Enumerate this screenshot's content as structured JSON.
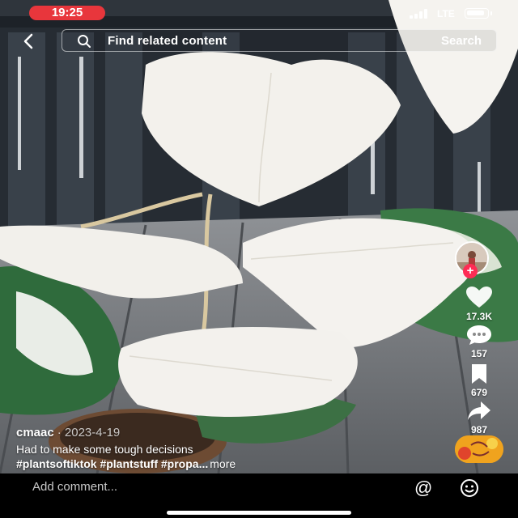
{
  "status_bar": {
    "time": "19:25",
    "network": "LTE",
    "battery_level": 0.9,
    "time_pill_color": "#e8363c"
  },
  "search": {
    "placeholder": "Find related content",
    "action_label": "Search"
  },
  "post": {
    "author": "cmaac",
    "date": "· 2023-4-19",
    "caption": "Had to make some tough decisions",
    "hashtags": "#plantsoftiktok #plantstuff #propa...",
    "more_label": "more"
  },
  "actions": {
    "likes": "17.3K",
    "comments": "157",
    "saves": "679",
    "shares": "987"
  },
  "comment_bar": {
    "placeholder": "Add comment...",
    "mention_symbol": "@"
  },
  "icons": [
    "back-arrow-icon",
    "search-icon",
    "heart-icon",
    "comment-icon",
    "bookmark-icon",
    "share-icon",
    "at-sign-icon",
    "emoji-icon"
  ],
  "colors": {
    "accent": "#fe2c55",
    "sound_disc": "#f0a31e"
  }
}
